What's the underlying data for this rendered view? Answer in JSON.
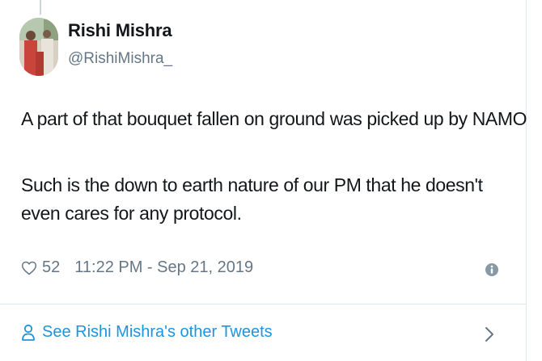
{
  "tweet": {
    "author_name": "Rishi Mishra",
    "author_handle": "@RishiMishra_",
    "paragraphs": [
      "A part of that bouquet fallen on ground was picked up by NAMO",
      "Such is the down to earth nature of our PM that he doesn't even cares for any protocol."
    ],
    "like_count": "52",
    "timestamp": "11:22 PM - Sep 21, 2019",
    "icons": {
      "like": "heart-icon",
      "info": "info-icon",
      "more_tweets": "person-icon",
      "open": "chevron-right-icon"
    }
  },
  "footer": {
    "see_more_label": "See Rishi Mishra's other Tweets"
  },
  "colors": {
    "text": "#14171a",
    "secondary": "#657786",
    "link": "#1b95e0",
    "border": "#e1e8ed"
  }
}
